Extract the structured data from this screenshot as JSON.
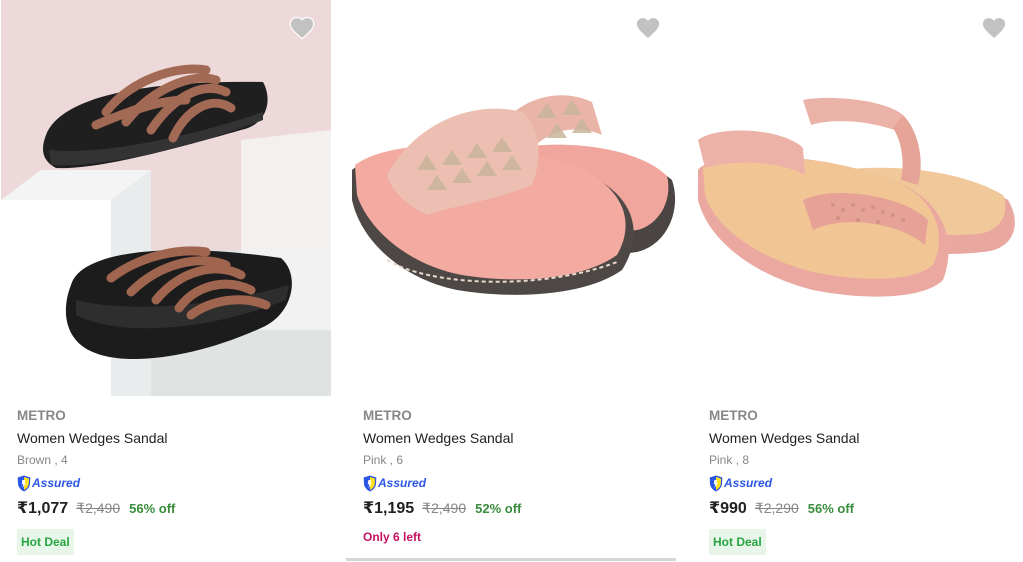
{
  "products": [
    {
      "brand": "METRO",
      "title": "Women Wedges Sandal",
      "variant": "Brown , 4",
      "assured": "Assured",
      "price": "₹1,077",
      "mrp": "₹2,490",
      "discount": "56% off",
      "tag": "Hot Deal",
      "image": "brown-strappy-platform-slides",
      "wishlist_icon": "heart-icon"
    },
    {
      "brand": "METRO",
      "title": "Women Wedges Sandal",
      "variant": "Pink , 6",
      "assured": "Assured",
      "price": "₹1,195",
      "mrp": "₹2,490",
      "discount": "52% off",
      "stock_note": "Only 6 left",
      "image": "pink-studded-wedge-thong",
      "wishlist_icon": "heart-icon"
    },
    {
      "brand": "METRO",
      "title": "Women Wedges Sandal",
      "variant": "Pink , 8",
      "assured": "Assured",
      "price": "₹990",
      "mrp": "₹2,290",
      "discount": "56% off",
      "tag": "Hot Deal",
      "image": "pink-elastic-strap-wedge",
      "wishlist_icon": "heart-icon"
    }
  ],
  "colors": {
    "brand_text": "#878787",
    "discount": "#388e3c",
    "deal_bg": "#e8f5e9",
    "deal_text": "#26a541",
    "stock_text": "#c51162",
    "assured": "#2a55e5"
  }
}
